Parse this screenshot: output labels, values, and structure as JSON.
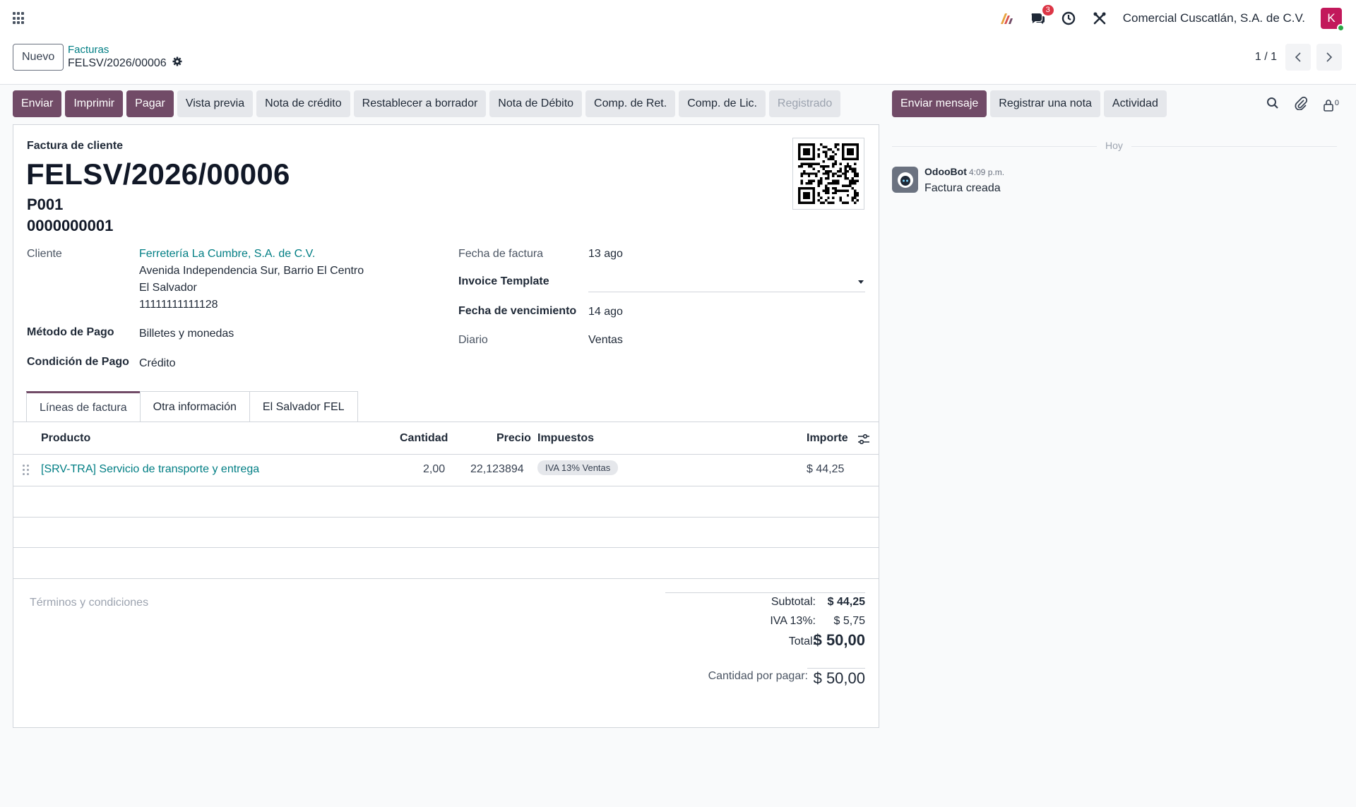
{
  "navbar": {
    "company": "Comercial Cuscatlán, S.A. de C.V.",
    "messages_count": "3",
    "user_initial": "K"
  },
  "control": {
    "new_label": "Nuevo",
    "breadcrumb_parent": "Facturas",
    "breadcrumb_current": "FELSV/2026/00006",
    "pager": "1 / 1"
  },
  "actions": {
    "send": "Enviar",
    "print": "Imprimir",
    "pay": "Pagar",
    "preview": "Vista previa",
    "credit_note": "Nota de crédito",
    "reset_draft": "Restablecer a borrador",
    "debit_note": "Nota de Débito",
    "comp_ret": "Comp. de Ret.",
    "comp_lic": "Comp. de Lic.",
    "status": "Registrado"
  },
  "chatter": {
    "send_message": "Enviar mensaje",
    "log_note": "Registrar una nota",
    "activity": "Actividad",
    "followers_count": "0",
    "day_label": "Hoy",
    "author": "OdooBot",
    "time": "4:09 p.m.",
    "message": "Factura creada"
  },
  "form": {
    "doc_type": "Factura de cliente",
    "name": "FELSV/2026/00006",
    "series": "P001",
    "correlative": "0000000001",
    "customer_label": "Cliente",
    "customer_name": "Ferretería La Cumbre, S.A. de C.V.",
    "customer_street": "Avenida Independencia Sur, Barrio El Centro",
    "customer_country": "El Salvador",
    "customer_vat": "11111111111128",
    "payment_method_label": "Método de Pago",
    "payment_method": "Billetes y monedas",
    "payment_condition_label": "Condición de Pago",
    "payment_condition": "Crédito",
    "invoice_date_label": "Fecha de factura",
    "invoice_date": "13 ago",
    "template_label": "Invoice Template",
    "template_value": "",
    "due_date_label": "Fecha de vencimiento",
    "due_date": "14 ago",
    "journal_label": "Diario",
    "journal": "Ventas"
  },
  "tabs": [
    "Líneas de factura",
    "Otra información",
    "El Salvador FEL"
  ],
  "lines": {
    "headers": {
      "product": "Producto",
      "quantity": "Cantidad",
      "price": "Precio",
      "taxes": "Impuestos",
      "amount": "Importe"
    },
    "rows": [
      {
        "product": "[SRV-TRA] Servicio de transporte y entrega",
        "quantity": "2,00",
        "price": "22,123894",
        "tax": "IVA 13% Ventas",
        "amount": "$ 44,25"
      }
    ]
  },
  "terms_placeholder": "Términos y condiciones",
  "totals": {
    "subtotal_label": "Subtotal:",
    "subtotal": "$ 44,25",
    "tax_label": "IVA 13%:",
    "tax": "$ 5,75",
    "total_label": "Total:",
    "total": "$ 50,00",
    "due_label": "Cantidad por pagar:",
    "due": "$ 50,00"
  },
  "colors": {
    "primary": "#714b67",
    "link": "#017e84",
    "avatar": "#c2185b"
  }
}
